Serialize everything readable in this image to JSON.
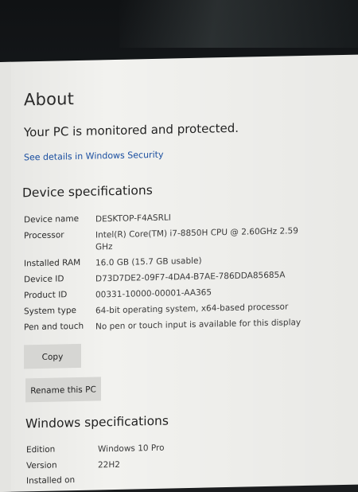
{
  "about": {
    "title": "About",
    "status": "Your PC is monitored and protected.",
    "security_link": "See details in Windows Security"
  },
  "device_specs": {
    "heading": "Device specifications",
    "rows": [
      {
        "label": "Device name",
        "value": "DESKTOP-F4ASRLI"
      },
      {
        "label": "Processor",
        "value": "Intel(R) Core(TM) i7-8850H CPU @ 2.60GHz   2.59 GHz"
      },
      {
        "label": "Installed RAM",
        "value": "16.0 GB (15.7 GB usable)"
      },
      {
        "label": "Device ID",
        "value": "D73D7DE2-09F7-4DA4-B7AE-786DDA85685A"
      },
      {
        "label": "Product ID",
        "value": "00331-10000-00001-AA365"
      },
      {
        "label": "System type",
        "value": "64-bit operating system, x64-based processor"
      },
      {
        "label": "Pen and touch",
        "value": "No pen or touch input is available for this display"
      }
    ],
    "copy_label": "Copy",
    "rename_label": "Rename this PC"
  },
  "windows_specs": {
    "heading": "Windows specifications",
    "rows": [
      {
        "label": "Edition",
        "value": "Windows 10 Pro"
      },
      {
        "label": "Version",
        "value": "22H2"
      },
      {
        "label": "Installed on",
        "value": ""
      }
    ]
  },
  "colors": {
    "screen_bg": "#f2f2ef",
    "link": "#1b4fa0",
    "button_bg": "#d6d6d3"
  }
}
